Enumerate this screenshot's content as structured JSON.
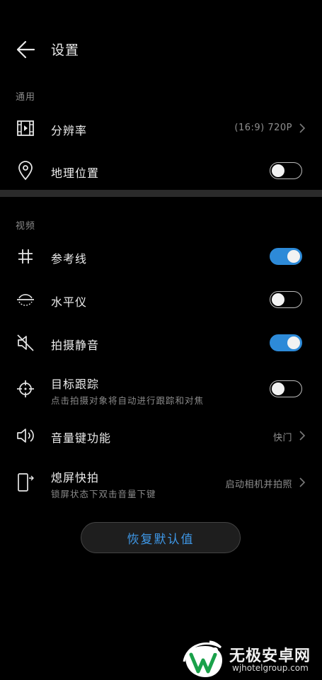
{
  "header": {
    "title": "设置",
    "back_icon": "arrow-left-icon"
  },
  "sections": {
    "general": "通用",
    "video": "视频"
  },
  "rows": {
    "resolution": {
      "title": "分辨率",
      "value": "(16:9) 720P",
      "icon": "film-icon"
    },
    "location": {
      "title": "地理位置",
      "toggle": false,
      "icon": "location-pin-icon"
    },
    "gridlines": {
      "title": "参考线",
      "toggle": true,
      "icon": "grid-icon"
    },
    "level": {
      "title": "水平仪",
      "toggle": false,
      "icon": "level-icon"
    },
    "mute": {
      "title": "拍摄静音",
      "toggle": true,
      "icon": "speaker-mute-icon"
    },
    "tracking": {
      "title": "目标跟踪",
      "subtitle": "点击拍摄对象将自动进行跟踪和对焦",
      "toggle": false,
      "icon": "crosshair-icon"
    },
    "volume_key": {
      "title": "音量键功能",
      "value": "快门",
      "icon": "speaker-icon"
    },
    "quick_snap": {
      "title": "熄屏快拍",
      "subtitle": "锁屏状态下双击音量下键",
      "value": "启动相机并拍照",
      "icon": "phone-snap-icon"
    }
  },
  "reset_button": {
    "label": "恢复默认值"
  },
  "watermark": {
    "title": "无极安卓网",
    "url": "wjhotelgroup.com"
  },
  "colors": {
    "accent": "#2d8ad8",
    "reset_text": "#3e97e6",
    "background": "#000000"
  }
}
